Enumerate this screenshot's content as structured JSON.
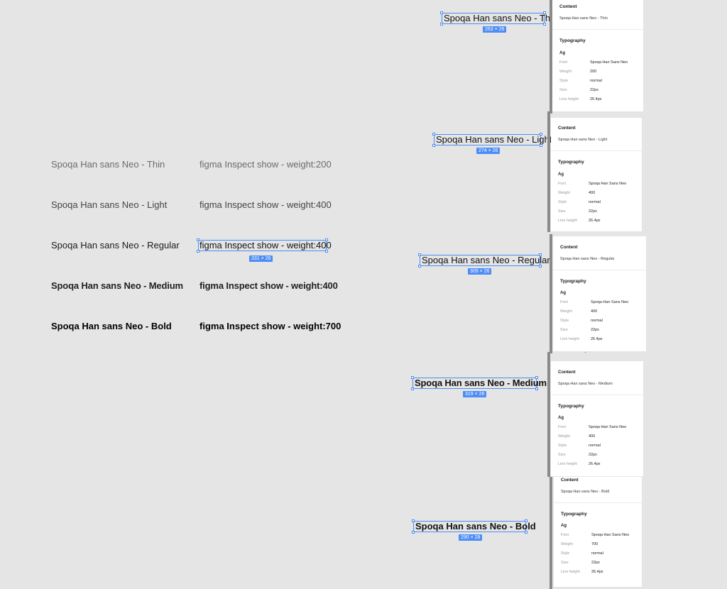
{
  "rows": [
    {
      "label": "Spoqa Han sans Neo - Thin",
      "note": "figma Inspect show - weight:200"
    },
    {
      "label": "Spoqa Han sans Neo - Light",
      "note": "figma Inspect show - weight:400"
    },
    {
      "label": "Spoqa Han sans Neo - Regular",
      "note": "figma Inspect show - weight:400"
    },
    {
      "label": "Spoqa Han sans Neo - Medium",
      "note": "figma Inspect show - weight:400"
    },
    {
      "label": "Spoqa Han sans Neo - Bold",
      "note": "figma Inspect show - weight:700"
    }
  ],
  "selected_note_dim": "331 × 26",
  "specimens": [
    {
      "text": "Spoqa Han sans Neo - Thin",
      "dim": "263 × 26"
    },
    {
      "text": "Spoqa Han sans Neo - Light",
      "dim": "274 × 26"
    },
    {
      "text": "Spoqa Han sans Neo - Regular",
      "dim": "309 × 26"
    },
    {
      "text": "Spoqa Han sans Neo - Medium",
      "dim": "319 × 26"
    },
    {
      "text": "Spoqa Han sans Neo - Bold",
      "dim": "290 × 28"
    }
  ],
  "inspect_labels": {
    "content": "Content",
    "typography": "Typography",
    "ag": "Ag",
    "font": "Font",
    "weight": "Weight",
    "style": "Style",
    "size": "Size",
    "line_height": "Line height"
  },
  "panels": [
    {
      "content": "Spoqa Han sans Neo - Thin",
      "font": "Spoqa Han Sans Neo",
      "weight": "200",
      "style": "normal",
      "size": "22px",
      "line_height": "26.4px"
    },
    {
      "content": "Spoqa Han sans Neo - Light",
      "font": "Spoqa Han Sans Neo",
      "weight": "400",
      "style": "normal",
      "size": "22px",
      "line_height": "26.4px"
    },
    {
      "content": "Spoqa Han sans Neo - Regular",
      "font": "Spoqa Han Sans Neo",
      "weight": "400",
      "style": "normal",
      "size": "22px",
      "line_height": "26.4px"
    },
    {
      "content": "Spoqa Han sans Neo - Medium",
      "font": "Spoqa Han Sans Neo",
      "weight": "400",
      "style": "normal",
      "size": "22px",
      "line_height": "26.4px"
    },
    {
      "content": "Spoqa Han sans Neo - Bold",
      "font": "Spoqa Han Sans Neo",
      "weight": "700",
      "style": "normal",
      "size": "22px",
      "line_height": "26.4px"
    }
  ],
  "colors": {
    "canvas": "#e5e5e5",
    "selection": "#4c8df6",
    "panel": "#ffffff"
  }
}
